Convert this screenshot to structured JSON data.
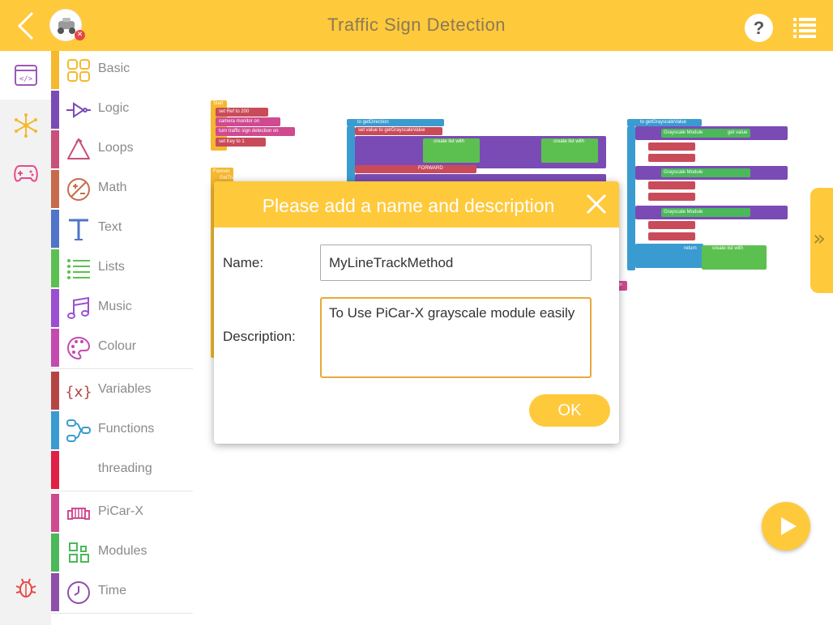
{
  "header": {
    "title": "Traffic Sign Detection",
    "help_label": "?",
    "device_status": "✕"
  },
  "rail": {
    "items": [
      {
        "name": "code-editor-icon",
        "color": "#9b59b6"
      },
      {
        "name": "connection-icon",
        "color": "#f5b82e"
      },
      {
        "name": "gamepad-icon",
        "color": "#e84a8a"
      },
      {
        "name": "debug-bug-icon",
        "color": "#e84545"
      }
    ]
  },
  "categories": [
    {
      "label": "Basic",
      "color": "#f5b82e"
    },
    {
      "label": "Logic",
      "color": "#7b4bb5"
    },
    {
      "label": "Loops",
      "color": "#c9507a"
    },
    {
      "label": "Math",
      "color": "#c86b4a"
    },
    {
      "label": "Text",
      "color": "#4f74c8"
    },
    {
      "label": "Lists",
      "color": "#5cc050"
    },
    {
      "label": "Music",
      "color": "#9b4fd1"
    },
    {
      "label": "Colour",
      "color": "#c44ab0"
    },
    {
      "label": "Variables",
      "color": "#b54545"
    },
    {
      "label": "Functions",
      "color": "#3a9bd1"
    },
    {
      "label": "threading",
      "color": "#e02045"
    },
    {
      "label": "PiCar-X",
      "color": "#d04a90"
    },
    {
      "label": "Modules",
      "color": "#4bb85a"
    },
    {
      "label": "Time",
      "color": "#8e4fa8"
    }
  ],
  "workspace": {
    "block_labels": {
      "start": "Start",
      "set_ref": "set Ref to 200",
      "camera_monitor": "camera monitor on",
      "traffic_detect": "turn traffic sign detection on",
      "set_key": "set Key to 1",
      "forever": "Forever",
      "get_traffic": "GetTraffic",
      "get_direction": "to getDirection",
      "set_value": "set value to getGrayscaleValue",
      "create_list": "create list with",
      "forward": "FORWARD",
      "get_grayscale": "to getGrayscaleValue",
      "grayscale_module": "Grayscale Module",
      "get_value": "get value",
      "return_label": "return",
      "sign": "sign"
    }
  },
  "dialog": {
    "title": "Please add a name and description",
    "name_label": "Name:",
    "name_value": "MyLineTrackMethod",
    "description_label": "Description:",
    "description_value": "To Use PiCar-X grayscale module easily",
    "ok_label": "OK"
  },
  "expand_tab": {
    "label": "»"
  },
  "colors": {
    "accent": "#ffc93c",
    "dialog_border_focus": "#e8a93a"
  }
}
